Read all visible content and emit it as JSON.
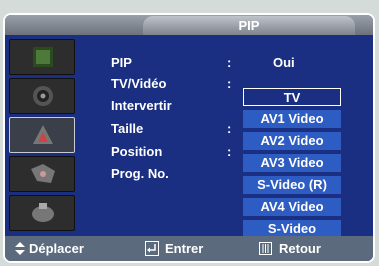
{
  "header": {
    "title": "PIP"
  },
  "icons": [
    {
      "name": "picture-icon"
    },
    {
      "name": "sound-icon"
    },
    {
      "name": "channel-icon"
    },
    {
      "name": "setup-icon"
    },
    {
      "name": "input-icon"
    }
  ],
  "menu": {
    "items": [
      {
        "label": "PIP",
        "value": "Oui"
      },
      {
        "label": "TV/Vidéo",
        "value": ""
      },
      {
        "label": "Intervertir",
        "value": ""
      },
      {
        "label": "Taille",
        "value": ""
      },
      {
        "label": "Position",
        "value": ""
      },
      {
        "label": "Prog. No.",
        "value": ""
      }
    ],
    "colon": ":"
  },
  "dropdown": {
    "selected_index": 0,
    "options": [
      "TV",
      "AV1 Video",
      "AV2 Video",
      "AV3 Video",
      "S-Video (R)",
      "AV4 Video",
      "S-Video"
    ]
  },
  "footer": {
    "move_label": "Déplacer",
    "enter_label": "Entrer",
    "return_label": "Retour"
  },
  "colors": {
    "background": "#1a2f82",
    "option_fill": "#2d5cc2",
    "footer": "#5c6a7e",
    "header": "#8a9099"
  }
}
